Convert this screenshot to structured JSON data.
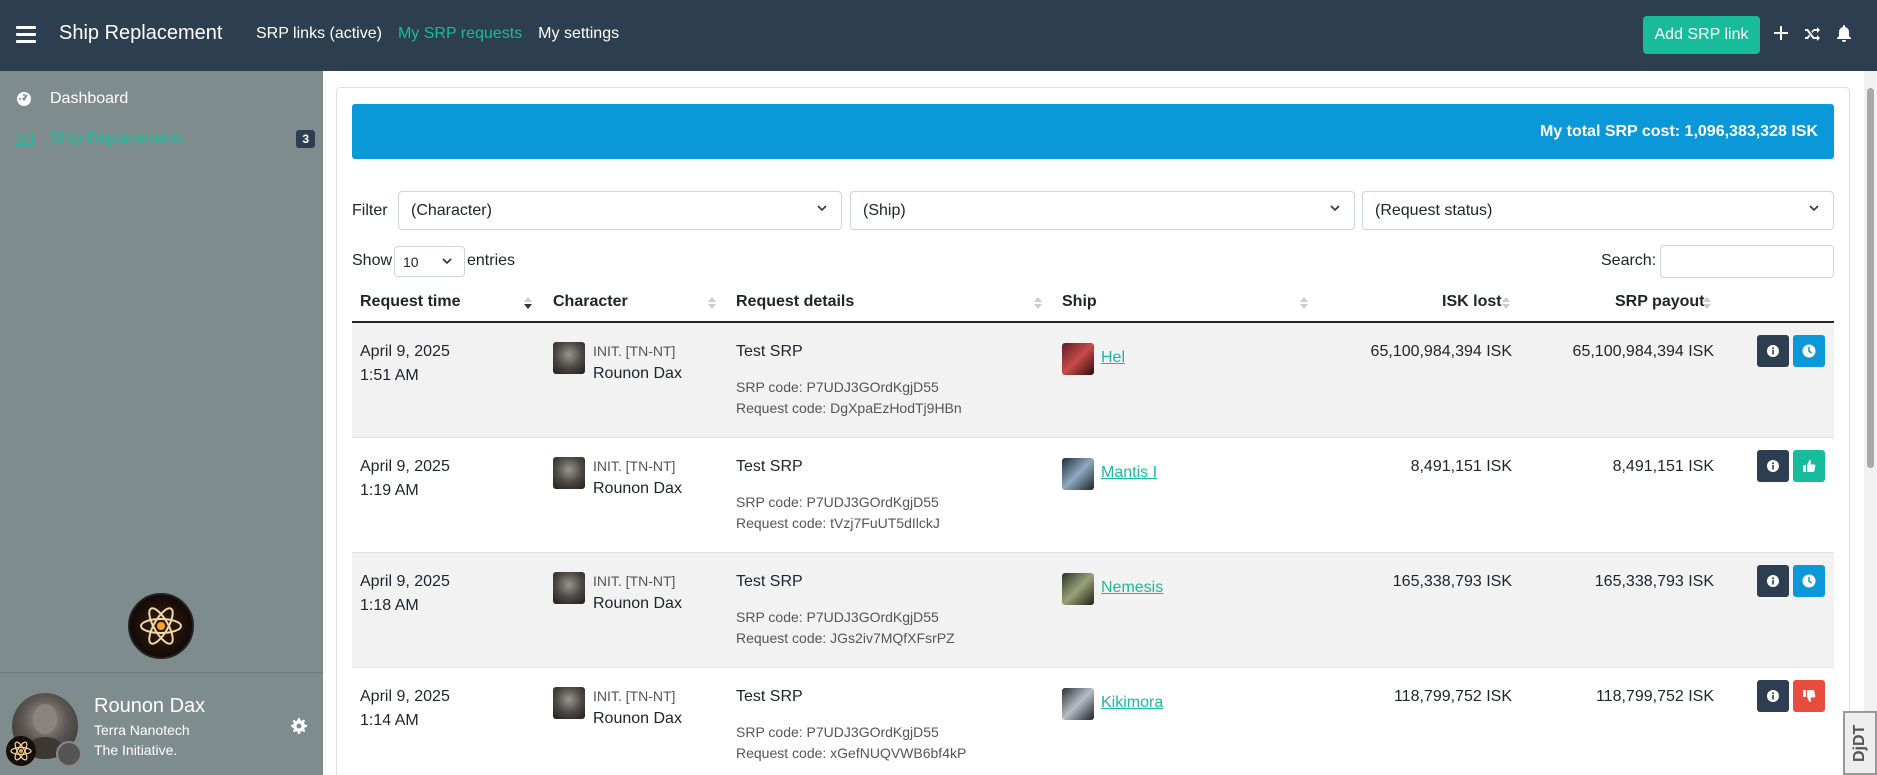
{
  "navbar": {
    "brand": "Ship Replacement",
    "links": [
      "SRP links (active)",
      "My SRP requests",
      "My settings"
    ],
    "active_link": "My SRP requests",
    "add_button": "Add SRP link"
  },
  "sidebar": {
    "items": [
      {
        "label": "Dashboard",
        "icon": "dashboard-icon"
      },
      {
        "label": "Ship Replacement",
        "icon": "money-bill-icon",
        "badge": "3",
        "active": true
      }
    ]
  },
  "user": {
    "name": "Rounon Dax",
    "corporation": "Terra Nanotech",
    "alliance": "The Initiative."
  },
  "summary": {
    "total_cost": "My total SRP cost: 1,096,383,328 ISK"
  },
  "filters": {
    "label": "Filter",
    "character": "(Character)",
    "ship": "(Ship)",
    "status": "(Request status)"
  },
  "table_controls": {
    "show": "Show",
    "page_length": "10",
    "entries": "entries",
    "search": "Search:"
  },
  "table": {
    "columns": [
      "Request time",
      "Character",
      "Request details",
      "Ship",
      "ISK lost",
      "SRP payout"
    ],
    "rows": [
      {
        "date": "April 9, 2025",
        "time": "1:51 AM",
        "corp": "INIT. [TN-NT]",
        "character": "Rounon Dax",
        "title": "Test SRP",
        "srp_code": "SRP code: P7UDJ3GOrdKgjD55",
        "request_code": "Request code: DgXpaEzHodTj9HBn",
        "ship": "Hel",
        "isk_lost": "65,100,984,394 ISK",
        "payout": "65,100,984,394 ISK",
        "status": "pending",
        "status_color": "#0b98d9"
      },
      {
        "date": "April 9, 2025",
        "time": "1:19 AM",
        "corp": "INIT. [TN-NT]",
        "character": "Rounon Dax",
        "title": "Test SRP",
        "srp_code": "SRP code: P7UDJ3GOrdKgjD55",
        "request_code": "Request code: tVzj7FuUT5dIlckJ",
        "ship": "Mantis I",
        "isk_lost": "8,491,151 ISK",
        "payout": "8,491,151 ISK",
        "status": "approved",
        "status_color": "#18bc9c"
      },
      {
        "date": "April 9, 2025",
        "time": "1:18 AM",
        "corp": "INIT. [TN-NT]",
        "character": "Rounon Dax",
        "title": "Test SRP",
        "srp_code": "SRP code: P7UDJ3GOrdKgjD55",
        "request_code": "Request code: JGs2iv7MQfXFsrPZ",
        "ship": "Nemesis",
        "isk_lost": "165,338,793 ISK",
        "payout": "165,338,793 ISK",
        "status": "pending",
        "status_color": "#0b98d9"
      },
      {
        "date": "April 9, 2025",
        "time": "1:14 AM",
        "corp": "INIT. [TN-NT]",
        "character": "Rounon Dax",
        "title": "Test SRP",
        "srp_code": "SRP code: P7UDJ3GOrdKgjD55",
        "request_code": "Request code: xGefNUQVWB6bf4kP",
        "ship": "Kikimora",
        "isk_lost": "118,799,752 ISK",
        "payout": "118,799,752 ISK",
        "status": "rejected",
        "status_color": "#e74c3c"
      }
    ]
  },
  "debug_toolbar": "DjDT",
  "colors": {
    "navbar": "#2c3e50",
    "accent": "#18bc9c",
    "info": "#0b98d9",
    "danger": "#e74c3c",
    "sidebar": "#7f8c8d"
  }
}
